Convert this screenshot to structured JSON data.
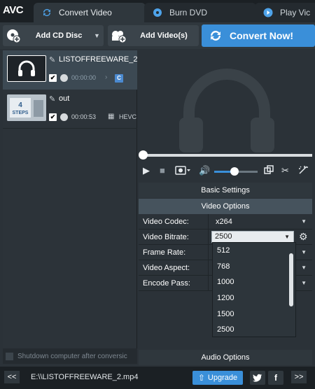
{
  "app": {
    "logo": "AVC"
  },
  "tabs": [
    {
      "label": "Convert Video",
      "icon": "convert-icon",
      "active": true
    },
    {
      "label": "Burn DVD",
      "icon": "disc-icon",
      "active": false
    },
    {
      "label": "Play Vic",
      "icon": "play-icon",
      "active": false
    }
  ],
  "toolbar": {
    "add_cd_label": "Add CD Disc",
    "add_video_label": "Add Video(s)",
    "convert_label": "Convert Now!"
  },
  "files": [
    {
      "name": "LISTOFFREEWARE_2",
      "duration": "00:00:00",
      "badge": "C",
      "thumb": "headphones-icon"
    },
    {
      "name": "out",
      "duration": "00:00:53",
      "codec": "HEVC",
      "thumb_text": "4\nSTEPS"
    }
  ],
  "shutdown_label": "Shutdown computer after conversic",
  "settings": {
    "basic_label": "Basic Settings",
    "video_label": "Video Options",
    "audio_label": "Audio Options",
    "rows": [
      {
        "key": "Video Codec:",
        "value": "x264"
      },
      {
        "key": "Video Bitrate:",
        "value": "2500"
      },
      {
        "key": "Frame Rate:",
        "value": ""
      },
      {
        "key": "Video Aspect:",
        "value": ""
      },
      {
        "key": "Encode Pass:",
        "value": ""
      }
    ],
    "bitrate_options": [
      "512",
      "768",
      "1000",
      "1200",
      "1500",
      "2500"
    ]
  },
  "bottom": {
    "path": "E:\\\\LISTOFFREEWARE_2.mp4",
    "upgrade_label": "Upgrade",
    "back_label": "<<",
    "forward_label": ">>"
  },
  "colors": {
    "accent": "#3a8fd9",
    "selected_row": "#3c4953",
    "section_active": "#46535d"
  },
  "player": {
    "volume_fraction": 0.5,
    "position_fraction": 0
  }
}
